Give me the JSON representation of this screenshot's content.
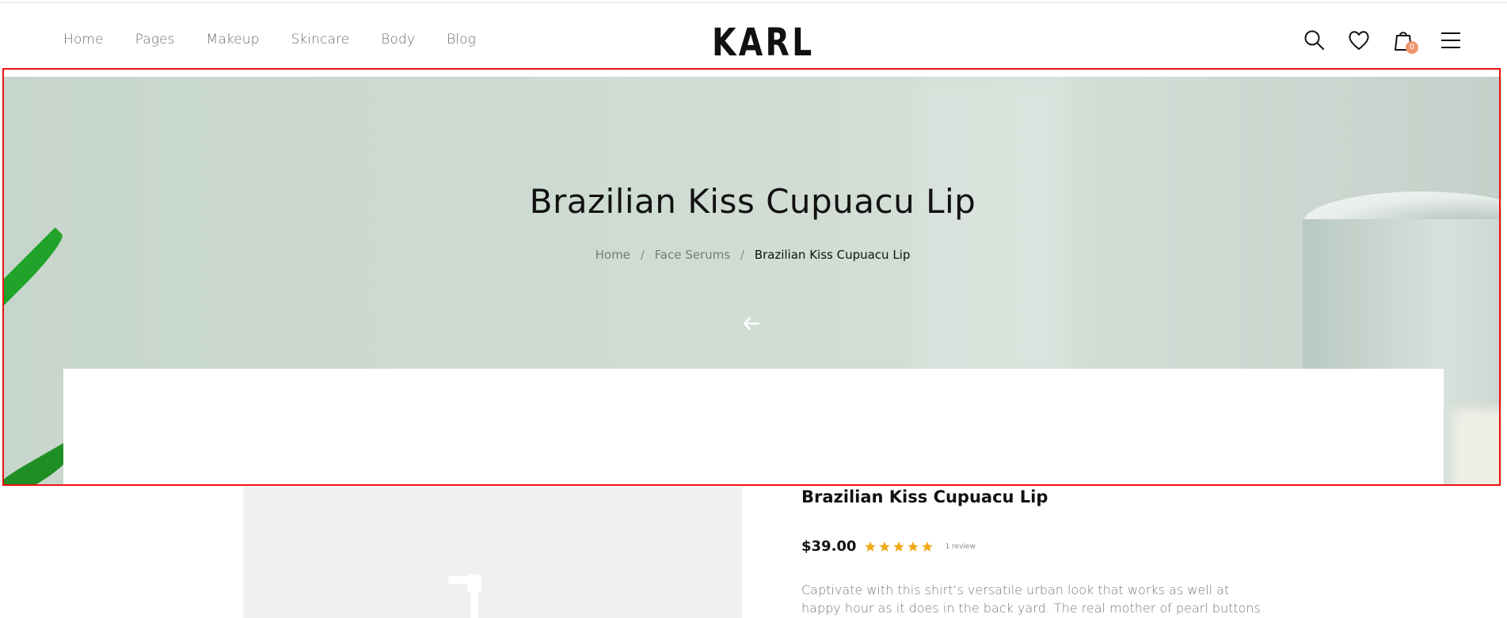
{
  "header": {
    "nav": [
      "Home",
      "Pages",
      "Makeup",
      "Skincare",
      "Body",
      "Blog"
    ],
    "logo": "KARL",
    "cart_count": "0"
  },
  "hero": {
    "title": "Brazilian Kiss Cupuacu Lip",
    "breadcrumb": [
      "Home",
      "Face Serums",
      "Brazilian Kiss Cupuacu Lip"
    ]
  },
  "product": {
    "title": "Brazilian Kiss Cupuacu Lip",
    "price": "$39.00",
    "rating": 5,
    "review_text": "1 review",
    "description": "Captivate with this shirt’s versatile urban look that works as well at happy hour as it does in the back yard. The real mother of pearl buttons and"
  },
  "colors": {
    "star": "#f2a917",
    "badge": "#f0946d",
    "hero_bg": "#cfdcd3"
  },
  "icons": [
    "search-icon",
    "heart-icon",
    "shopping-bag-icon",
    "menu-icon",
    "arrow-left-icon",
    "star-icon"
  ]
}
